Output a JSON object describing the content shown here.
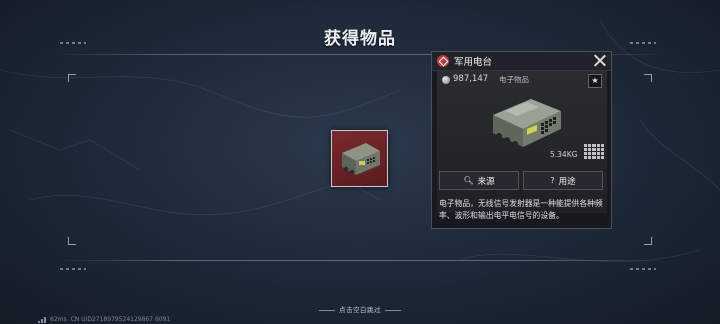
{
  "title": "获得物品",
  "item": {
    "name": "军用电台",
    "value": "987,147",
    "category": "电子物品",
    "weight": "5.34KG",
    "rarity_color": "#c03a3a",
    "slot_background": "#6b2326"
  },
  "buttons": {
    "source": {
      "label": "来源",
      "icon": "search-icon"
    },
    "usage": {
      "label": "用途",
      "icon": "question-icon"
    },
    "favorite_icon": "star-icon",
    "close_icon": "close-icon"
  },
  "description": "电子物品，无线信号发射器是一种能提供各种频率、波形和输出电平电信号的设备。",
  "hint": "点击空白跳过",
  "status": {
    "ping": "62ms",
    "uid": "CN UID2718979524129867 6091"
  }
}
